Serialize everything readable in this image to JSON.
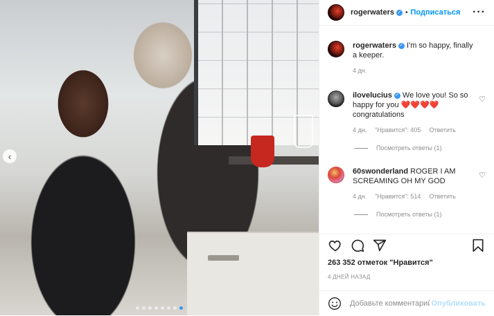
{
  "post": {
    "username": "rogerwaters",
    "follow_label": "Подписаться",
    "separator": "•",
    "more_label": "···",
    "carousel_prev": "‹",
    "carousel": {
      "total": 8,
      "active_index": 7
    }
  },
  "caption": {
    "username": "rogerwaters",
    "text": "I'm so happy, finally a keeper.",
    "age": "4 дн."
  },
  "comments": [
    {
      "username": "ilovelucius",
      "text": "We love you! So so happy for you",
      "hearts": "❤️❤️❤️❤️",
      "text2": "congratulations",
      "age": "4 дн.",
      "likes": "\"Нравится\": 405",
      "reply_label": "Ответить",
      "view_replies": "Посмотреть ответы (1)"
    },
    {
      "username": "60swonderland",
      "text": "ROGER I AM SCREAMING OH MY GOD",
      "age": "4 дн.",
      "likes": "\"Нравится\": 514",
      "reply_label": "Ответить",
      "view_replies": "Посмотреть ответы (1)"
    }
  ],
  "actions": {
    "likes_count": "263 352 отметок \"Нравится\"",
    "timestamp": "4 ДНЕЙ НАЗАД"
  },
  "add_comment": {
    "placeholder": "Добавьте комментарий...",
    "post_label": "Опубликовать"
  },
  "colors": {
    "link": "#0095f6",
    "verified": "#3897f0",
    "heart": "#ed4956",
    "post_disabled": "#b2dffc"
  }
}
